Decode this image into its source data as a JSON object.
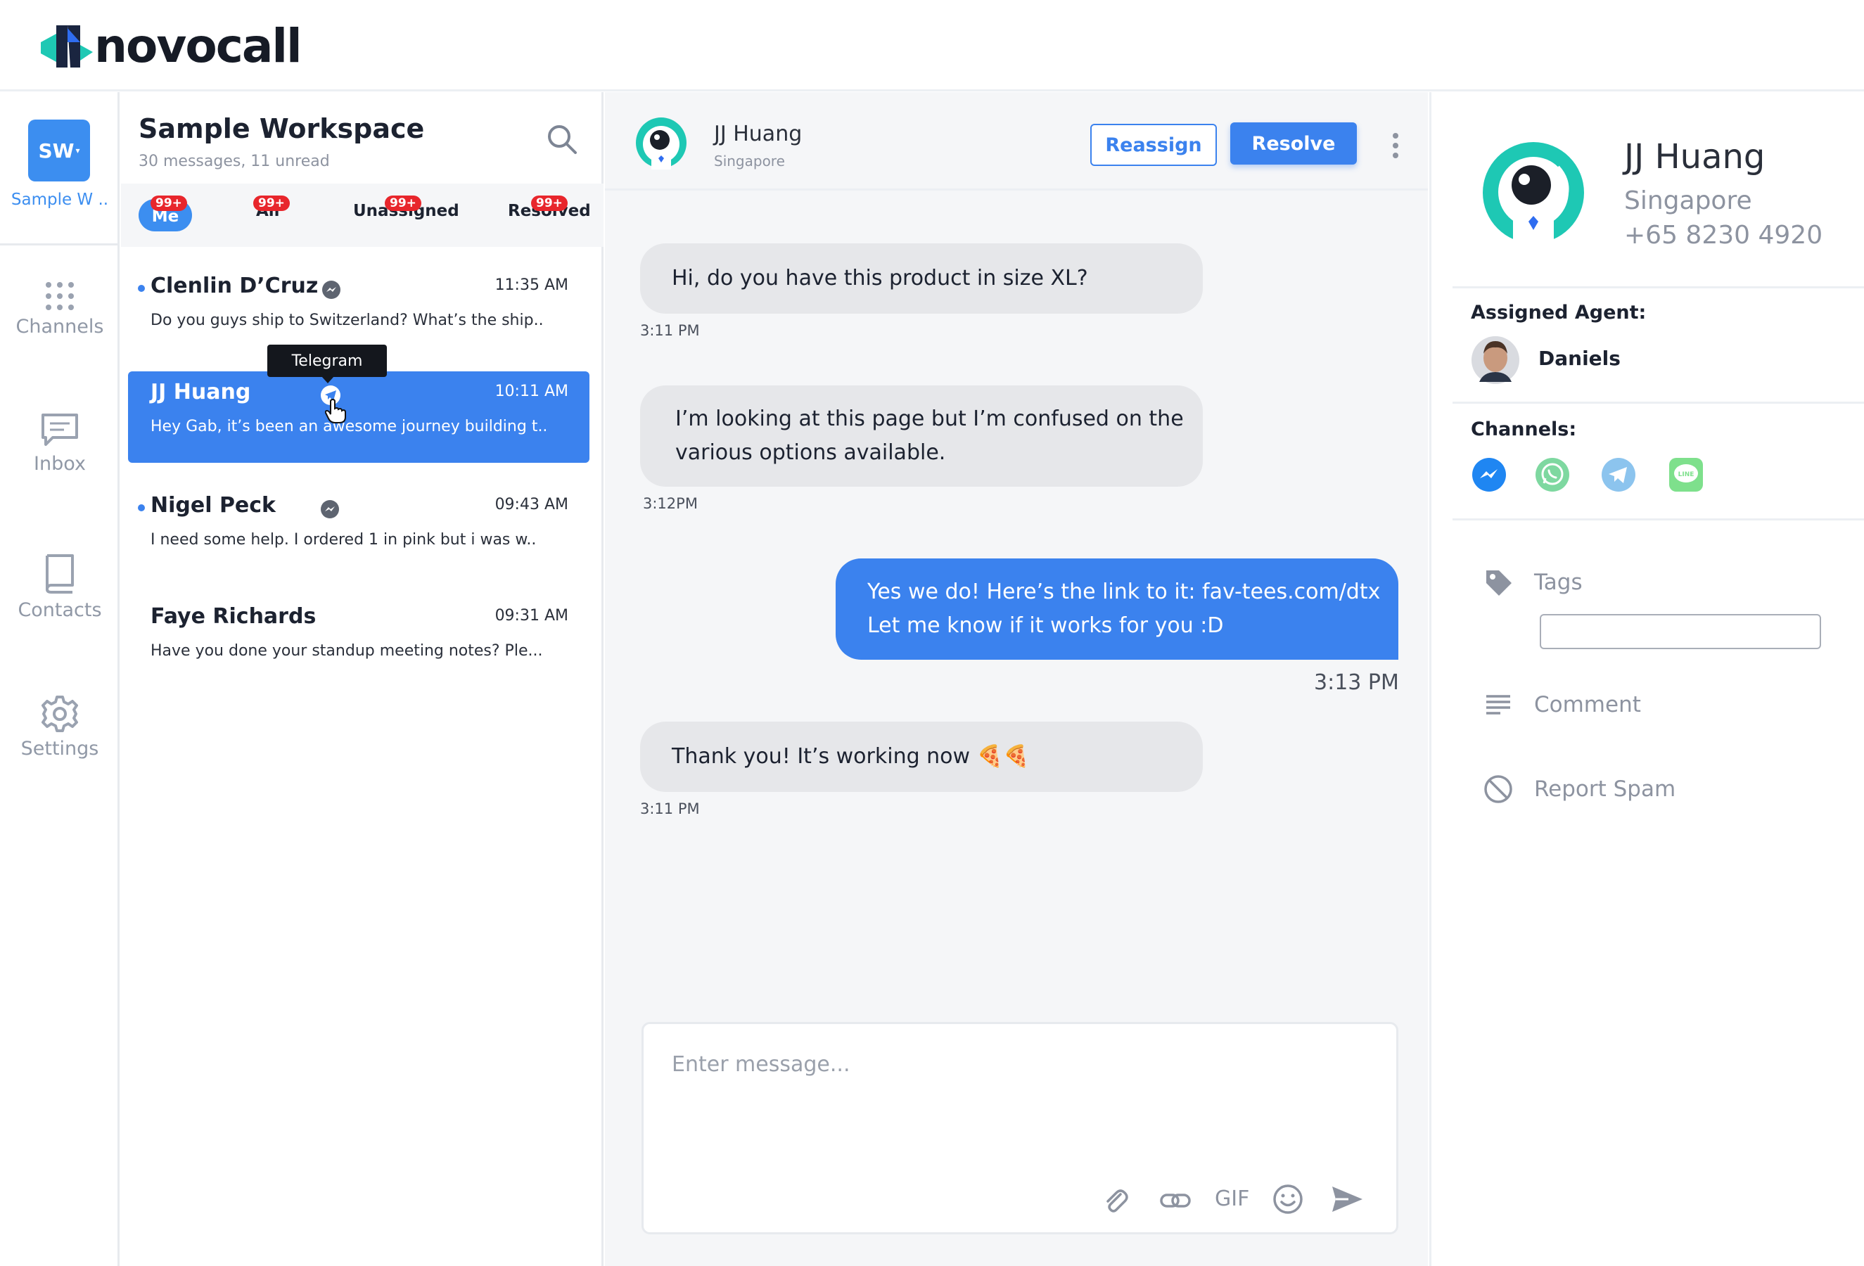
{
  "app": {
    "logo_text": "novocall"
  },
  "nav": {
    "workspace_initials": "SW",
    "workspace_short": "Sample W ..",
    "items": [
      {
        "label": "Channels",
        "icon": "grid-dots-icon"
      },
      {
        "label": "Inbox",
        "icon": "chat-bubble-icon"
      },
      {
        "label": "Contacts",
        "icon": "book-icon"
      },
      {
        "label": "Settings",
        "icon": "gear-icon"
      }
    ]
  },
  "workspace": {
    "title": "Sample Workspace",
    "subtitle": "30 messages, 11 unread",
    "tabs": [
      {
        "label": "Me",
        "badge": "99+",
        "active": true
      },
      {
        "label": "All",
        "badge": "99+"
      },
      {
        "label": "Unassigned",
        "badge": "99+"
      },
      {
        "label": "Resolved",
        "badge": "99+"
      }
    ]
  },
  "conversations": [
    {
      "name": "Clenlin D’Cruz",
      "time": "11:35 AM",
      "preview": "Do you guys ship to Switzerland? What’s the ship..",
      "unread": true,
      "channel": "messenger-icon"
    },
    {
      "name": "JJ Huang",
      "time": "10:11 AM",
      "preview": "Hey Gab, it’s been an awesome journey building t..",
      "unread": false,
      "channel": "telegram-icon",
      "active": true
    },
    {
      "name": "Nigel Peck",
      "time": "09:43 AM",
      "preview": "I need some help. I ordered 1 in pink but i was w..",
      "unread": true,
      "channel": "messenger-icon"
    },
    {
      "name": "Faye Richards",
      "time": "09:31 AM",
      "preview": "Have you done your standup meeting notes? Ple...",
      "unread": false
    }
  ],
  "tooltip": {
    "text": "Telegram"
  },
  "chat": {
    "contact_name": "JJ Huang",
    "contact_location": "Singapore",
    "reassign_label": "Reassign",
    "resolve_label": "Resolve",
    "messages": [
      {
        "direction": "in",
        "lines": [
          "Hi, do you have this product in size XL?"
        ],
        "time": "3:11 PM"
      },
      {
        "direction": "in",
        "lines": [
          "I’m looking at this page but I’m confused on the",
          "various options available."
        ],
        "time": "3:12PM"
      },
      {
        "direction": "out",
        "lines": [
          "Yes we do! Here’s the link to it: fav-tees.com/dtx",
          "Let me know if it works for you :D"
        ],
        "time": "3:13 PM"
      },
      {
        "direction": "in",
        "lines": [
          "Thank you! It’s working now 🍕🍕"
        ],
        "time": "3:11 PM"
      }
    ],
    "composer": {
      "placeholder": "Enter message...",
      "gif_label": "GIF",
      "tools": [
        "paperclip-icon",
        "link-icon",
        "gif-icon",
        "smiley-icon",
        "send-icon"
      ]
    }
  },
  "profile": {
    "name": "JJ Huang",
    "location": "Singapore",
    "phone": "+65 8230 4920",
    "assigned_agent_label": "Assigned Agent:",
    "agent_name": "Daniels",
    "channels_label": "Channels:",
    "channels": [
      {
        "icon": "messenger-icon",
        "color": "#1f86f2"
      },
      {
        "icon": "whatsapp-icon",
        "color": "#7ed8a0"
      },
      {
        "icon": "telegram-icon",
        "color": "#8cc4ee"
      },
      {
        "icon": "line-icon",
        "color": "#7ee08c"
      }
    ],
    "tags_label": "Tags",
    "comment_label": "Comment",
    "report_spam_label": "Report Spam"
  },
  "colors": {
    "accent": "#3b82ee",
    "badge_red": "#e8262c",
    "brand_teal": "#1ec8b4"
  }
}
